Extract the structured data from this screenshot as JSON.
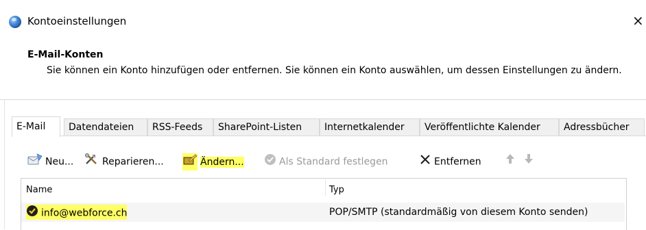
{
  "window": {
    "title": "Kontoeinstellungen",
    "close": "×"
  },
  "header": {
    "title": "E-Mail-Konten",
    "description": "Sie können ein Konto hinzufügen oder entfernen. Sie können ein Konto auswählen, um dessen Einstellungen zu ändern."
  },
  "tabs": [
    "E-Mail",
    "Datendateien",
    "RSS-Feeds",
    "SharePoint-Listen",
    "Internetkalender",
    "Veröffentlichte Kalender",
    "Adressbücher"
  ],
  "toolbar": {
    "new": "Neu...",
    "repair": "Reparieren...",
    "change": "Ändern...",
    "set_default": "Als Standard festlegen",
    "remove": "Entfernen"
  },
  "list": {
    "columns": {
      "name": "Name",
      "type": "Typ"
    },
    "rows": [
      {
        "name": "info@webforce.ch",
        "type": "POP/SMTP (standardmäßig von diesem Konto senden)"
      }
    ]
  },
  "colors": {
    "highlight": "#ffff66",
    "selection_row": "#f5f5f5"
  }
}
